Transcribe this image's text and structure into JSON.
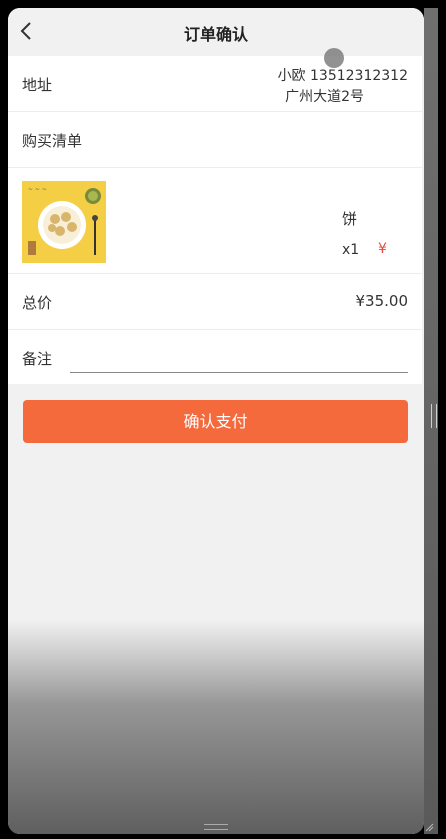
{
  "header": {
    "title": "订单确认",
    "back_icon": "chevron-left-icon"
  },
  "address": {
    "label": "地址",
    "line1": "小欧 13512312312",
    "line2": "广州大道2号"
  },
  "shopping_list": {
    "label": "购买清单"
  },
  "product": {
    "image_icon": "product-image",
    "name": "饼",
    "quantity": "x1",
    "price": "¥"
  },
  "total": {
    "label": "总价",
    "value": "¥35.00"
  },
  "remark": {
    "label": "备注",
    "value": ""
  },
  "actions": {
    "pay_label": "确认支付"
  },
  "colors": {
    "accent": "#f56a3d",
    "price_red": "#e34a3b",
    "background": "#f1f1f1"
  }
}
